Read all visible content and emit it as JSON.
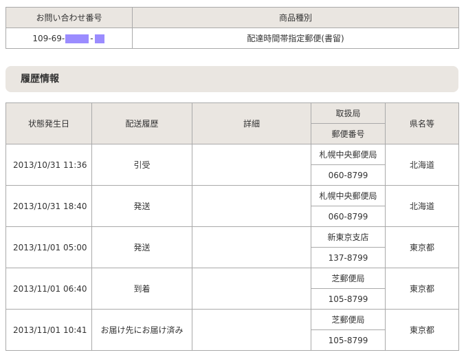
{
  "inquiry": {
    "headers": [
      "お問い合わせ番号",
      "商品種別"
    ],
    "number_prefix": "109-69-",
    "number_dash": "-",
    "product_type": "配達時間帯指定郵便(書留)"
  },
  "history": {
    "section_title": "履歴情報",
    "headers": {
      "date": "状態発生日",
      "status": "配送履歴",
      "detail": "詳細",
      "office": "取扱局",
      "postal": "郵便番号",
      "prefecture": "県名等"
    },
    "rows": [
      {
        "date": "2013/10/31 11:36",
        "status": "引受",
        "detail": "",
        "office": "札幌中央郵便局",
        "postal": "060-8799",
        "prefecture": "北海道"
      },
      {
        "date": "2013/10/31 18:40",
        "status": "発送",
        "detail": "",
        "office": "札幌中央郵便局",
        "postal": "060-8799",
        "prefecture": "北海道"
      },
      {
        "date": "2013/11/01 05:00",
        "status": "発送",
        "detail": "",
        "office": "新東京支店",
        "postal": "137-8799",
        "prefecture": "東京都"
      },
      {
        "date": "2013/11/01 06:40",
        "status": "到着",
        "detail": "",
        "office": "芝郵便局",
        "postal": "105-8799",
        "prefecture": "東京都"
      },
      {
        "date": "2013/11/01 10:41",
        "status": "お届け先にお届け済み",
        "detail": "",
        "office": "芝郵便局",
        "postal": "105-8799",
        "prefecture": "東京都"
      }
    ]
  },
  "colors": {
    "header_bg": "#eae6e1",
    "border": "#a9a9a9",
    "redaction": "#9b8cff"
  }
}
